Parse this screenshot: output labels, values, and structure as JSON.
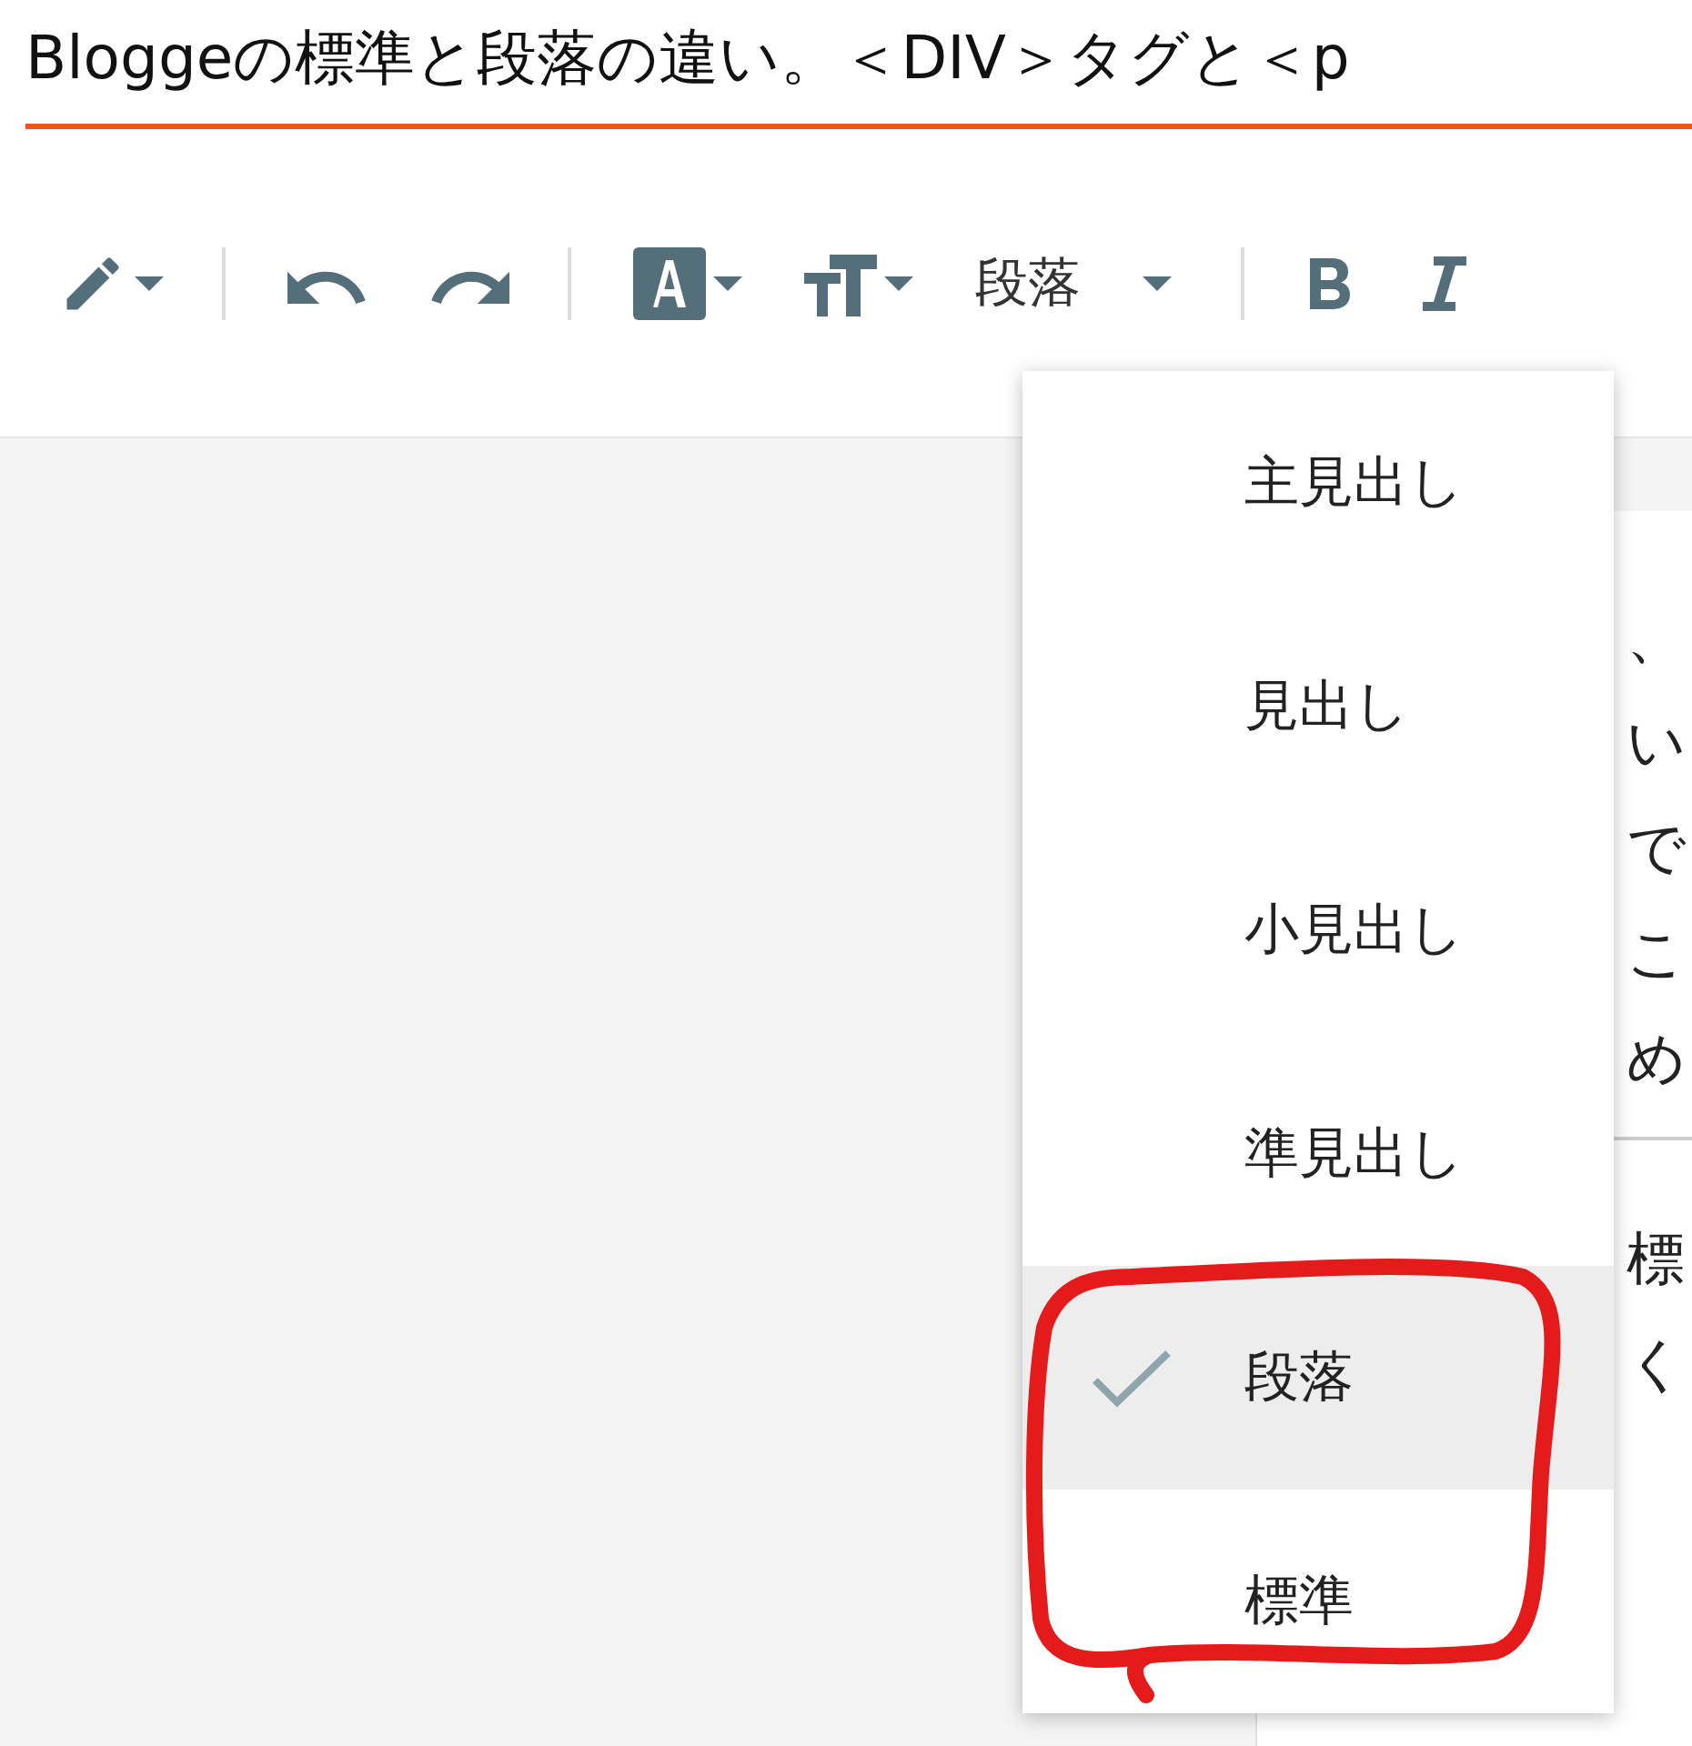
{
  "title": "Bloggeの標準と段落の違い。＜DIV＞タグと＜p",
  "toolbar": [
    {
      "kind": "pen"
    },
    {
      "kind": "divider"
    },
    {
      "kind": "undo"
    },
    {
      "kind": "redo"
    },
    {
      "kind": "divider"
    },
    {
      "kind": "textcolor"
    },
    {
      "kind": "fontsize"
    },
    {
      "kind": "format",
      "label": "段落"
    },
    {
      "kind": "divider"
    },
    {
      "kind": "bold"
    },
    {
      "kind": "italic"
    }
  ],
  "format_menu": [
    {
      "label": "主見出し",
      "selected": false
    },
    {
      "label": "見出し",
      "selected": false
    },
    {
      "label": "小見出し",
      "selected": false
    },
    {
      "label": "準見出し",
      "selected": false
    },
    {
      "label": "段落",
      "selected": true
    },
    {
      "label": "標準",
      "selected": false
    }
  ],
  "document_fragments": [
    {
      "kind": "text",
      "text": "、"
    },
    {
      "kind": "text",
      "text": "い"
    },
    {
      "kind": "text",
      "text": "で"
    },
    {
      "kind": "text",
      "text": "こ"
    },
    {
      "kind": "text",
      "text": "め"
    },
    {
      "kind": "rule"
    },
    {
      "kind": "text",
      "text": "標"
    },
    {
      "kind": "text",
      "text": "く"
    }
  ]
}
